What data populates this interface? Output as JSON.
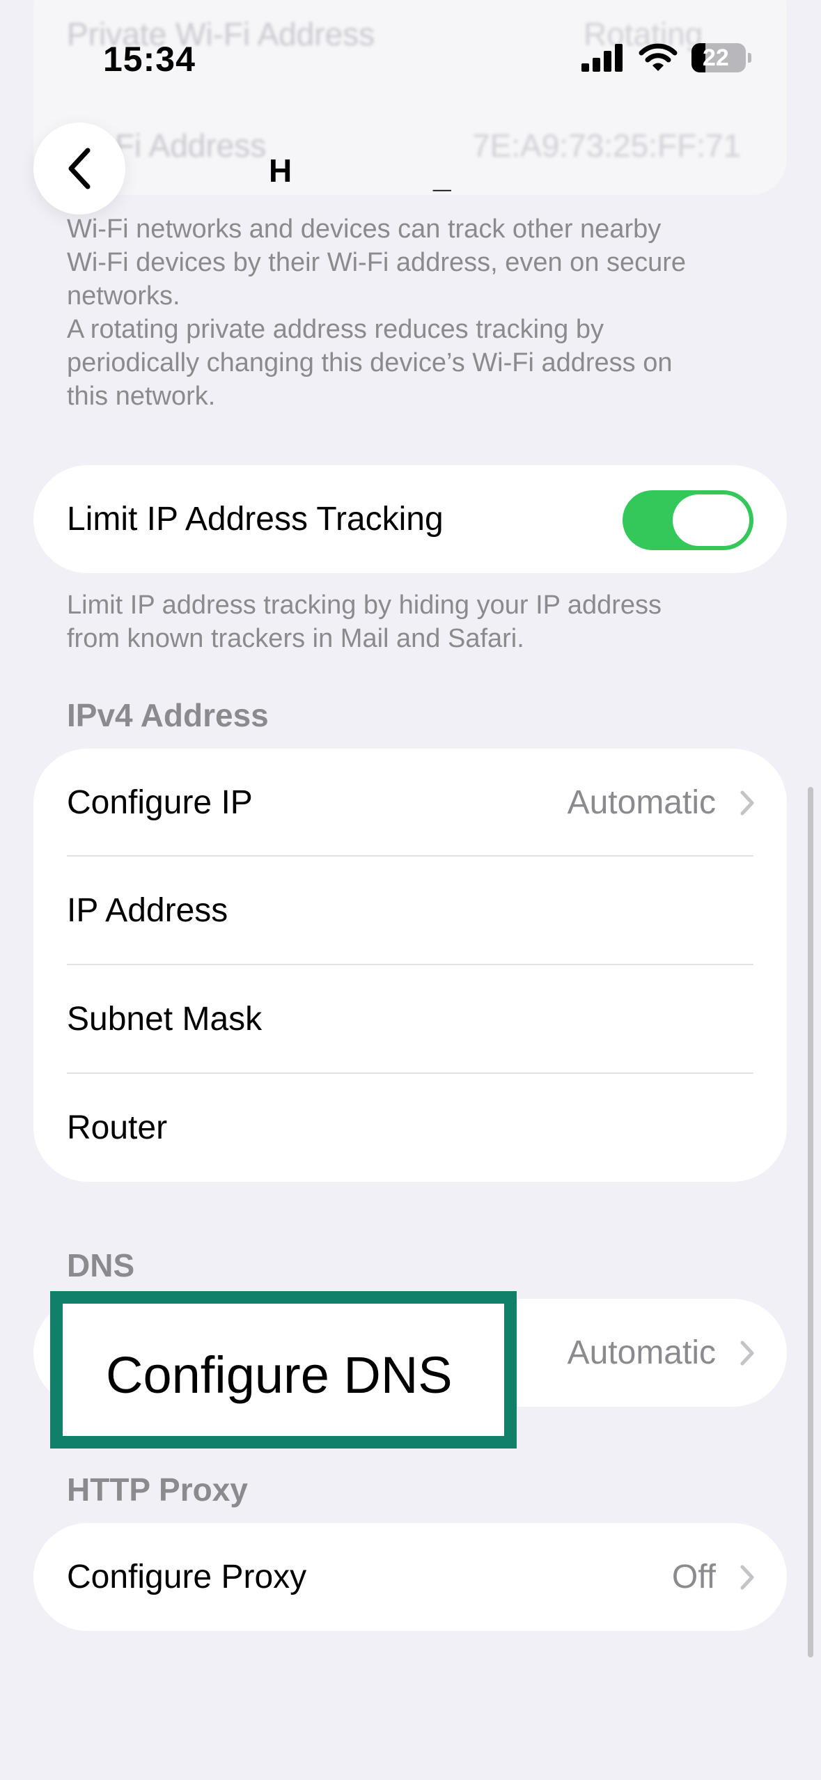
{
  "status_bar": {
    "time": "15:34",
    "battery": "22"
  },
  "ghost_header": {
    "row1_label": "Private Wi-Fi Address",
    "row1_value": "Rotating",
    "row2_label": "Wi-Fi Address",
    "row2_value": "7E:A9:73:25:FF:71"
  },
  "nav": {
    "title_fragment_1": "H",
    "title_fragment_2": "_"
  },
  "private_address_footer": [
    "Wi-Fi networks and devices can track other nearby",
    "Wi-Fi devices by their Wi-Fi address, even on secure",
    "networks.",
    "A rotating private address reduces tracking by",
    "periodically changing this device’s Wi-Fi address on",
    "this network."
  ],
  "limit_ip": {
    "label": "Limit IP Address Tracking",
    "enabled": true,
    "footer": [
      "Limit IP address tracking by hiding your IP address",
      "from known trackers in Mail and Safari."
    ]
  },
  "ipv4": {
    "header": "IPv4 Address",
    "rows": [
      {
        "label": "Configure IP",
        "value": "Automatic"
      },
      {
        "label": "IP Address",
        "value": ""
      },
      {
        "label": "Subnet Mask",
        "value": ""
      },
      {
        "label": "Router",
        "value": ""
      }
    ]
  },
  "dns": {
    "header": "DNS",
    "configure_label": "Configure DNS",
    "configure_value": "Automatic"
  },
  "proxy": {
    "header": "HTTP Proxy",
    "label": "Configure Proxy",
    "value": "Off"
  },
  "colors": {
    "background": "#f1f0f6",
    "toggle_on": "#34c759",
    "highlight_border": "#11806a",
    "secondary_text": "#8a8a8f"
  }
}
